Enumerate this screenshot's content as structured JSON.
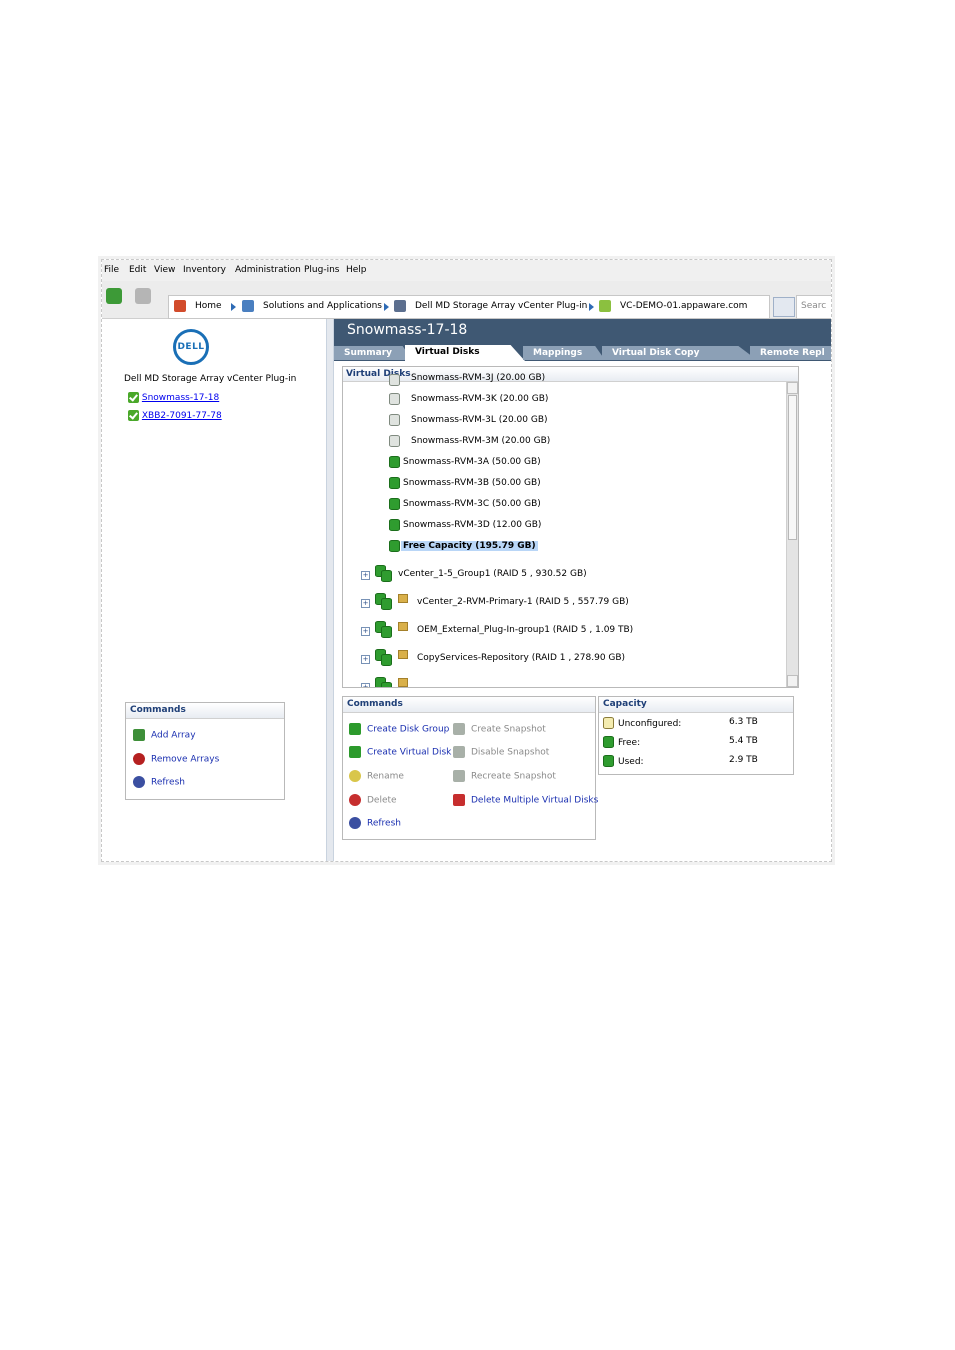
{
  "menu": [
    "File",
    "Edit",
    "View",
    "Inventory",
    "Administration",
    "Plug-ins",
    "Help"
  ],
  "breadcrumbs": [
    "Home",
    "Solutions and Applications",
    "Dell MD Storage Array vCenter Plug-in",
    "VC-DEMO-01.appaware.com"
  ],
  "search": {
    "placeholder": "Searc"
  },
  "left": {
    "logo_text": "DELL",
    "plugin_title": "Dell MD Storage Array vCenter Plug-in",
    "arrays": [
      "Snowmass-17-18",
      "XBB2-7091-77-78"
    ],
    "commands": {
      "title": "Commands",
      "items": [
        "Add Array",
        "Remove Arrays",
        "Refresh"
      ]
    }
  },
  "main": {
    "title": "Snowmass-17-18",
    "tabs": [
      "Summary",
      "Virtual Disks",
      "Mappings",
      "Virtual Disk Copy",
      "Remote Repl"
    ],
    "active_tab": "Virtual Disks",
    "virtual_disks": {
      "title": "Virtual Disks",
      "items": [
        "Snowmass-RVM-3J (20.00 GB)",
        "Snowmass-RVM-3K (20.00 GB)",
        "Snowmass-RVM-3L (20.00 GB)",
        "Snowmass-RVM-3M (20.00 GB)",
        "Snowmass-RVM-3A (50.00 GB)",
        "Snowmass-RVM-3B (50.00 GB)",
        "Snowmass-RVM-3C (50.00 GB)",
        "Snowmass-RVM-3D (12.00 GB)",
        "Free Capacity (195.79 GB)"
      ],
      "groups": [
        "vCenter_1-5_Group1 (RAID 5 , 930.52 GB)",
        "vCenter_2-RVM-Primary-1 (RAID 5 , 557.79 GB)",
        "OEM_External_Plug-In-group1 (RAID 5 , 1.09 TB)",
        "CopyServices-Repository (RAID 1 , 278.90 GB)"
      ]
    },
    "commands": {
      "title": "Commands",
      "left": [
        "Create Disk Group",
        "Create Virtual Disk",
        "Rename",
        "Delete",
        "Refresh"
      ],
      "right": [
        "Create Snapshot",
        "Disable Snapshot",
        "Recreate Snapshot",
        "Delete Multiple Virtual Disks"
      ]
    },
    "capacity": {
      "title": "Capacity",
      "rows": [
        {
          "label": "Unconfigured:",
          "value": "6.3 TB"
        },
        {
          "label": "Free:",
          "value": "5.4 TB"
        },
        {
          "label": "Used:",
          "value": "2.9 TB"
        }
      ]
    }
  }
}
